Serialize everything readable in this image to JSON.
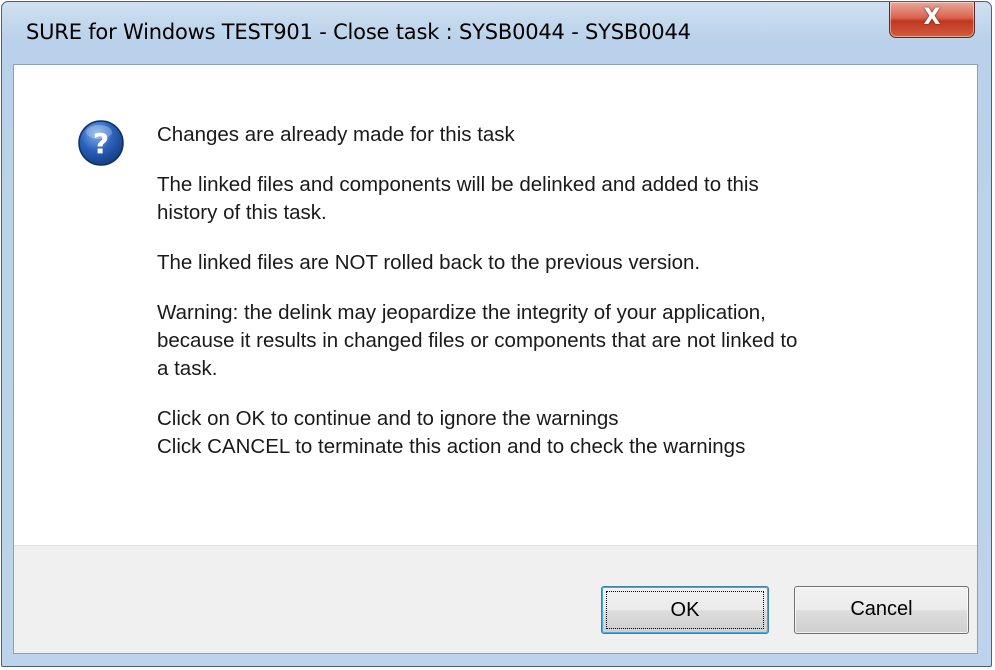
{
  "window": {
    "title": "SURE for Windows TEST901 - Close task : SYSB0044 - SYSB0044",
    "close_glyph": "X"
  },
  "dialog": {
    "icon": "question-icon",
    "messages": [
      "Changes are already made for this task",
      "The linked files and components will be delinked and added to this\nhistory of this task.",
      "The linked files are NOT rolled back to the previous version.",
      "Warning: the delink may jeopardize the integrity of your application,\nbecause it results in changed files or components that are not linked to\na task.",
      "Click on OK  to continue and to ignore the warnings\nClick CANCEL to terminate this action and to check the warnings"
    ]
  },
  "buttons": {
    "ok_label": "OK",
    "cancel_label": "Cancel"
  },
  "colors": {
    "icon_blue": "#2a5fb8",
    "close_red": "#c03822",
    "titlebar": "#bcd3eb"
  }
}
